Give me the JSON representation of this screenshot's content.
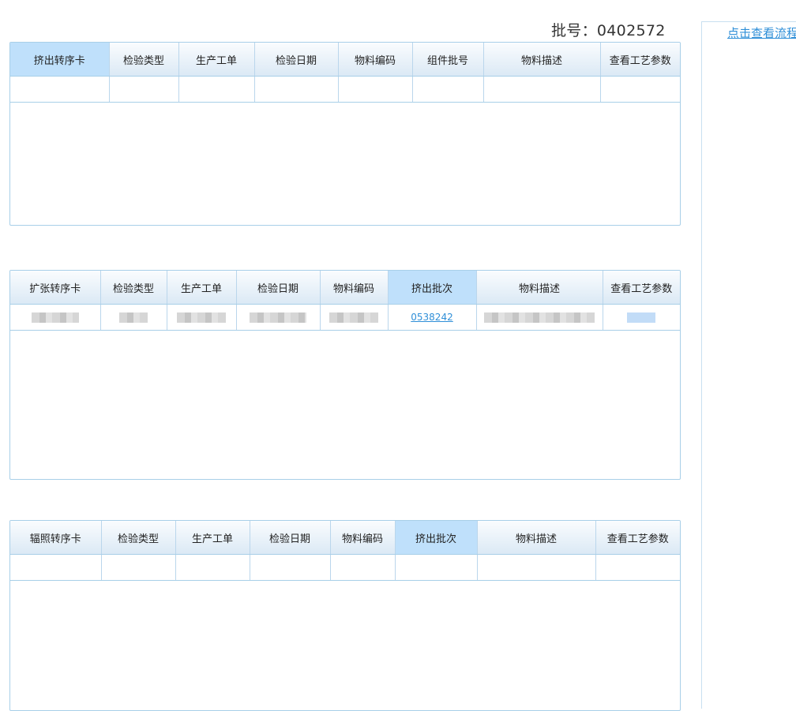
{
  "batch": {
    "label": "批号：",
    "value": "0402572"
  },
  "side": {
    "link_text": "点击查看流程"
  },
  "extrusion_table": {
    "columns": [
      "挤出转序卡",
      "检验类型",
      "生产工单",
      "检验日期",
      "物料编码",
      "组件批号",
      "物料描述",
      "查看工艺参数"
    ],
    "selected_column": 0
  },
  "expansion_table": {
    "columns": [
      "扩张转序卡",
      "检验类型",
      "生产工单",
      "检验日期",
      "物料编码",
      "挤出批次",
      "物料描述",
      "查看工艺参数"
    ],
    "selected_column": 5,
    "row": {
      "extrusion_batch": "0538242"
    }
  },
  "irradiation_table": {
    "columns": [
      "辐照转序卡",
      "检验类型",
      "生产工单",
      "检验日期",
      "物料编码",
      "挤出批次",
      "物料描述",
      "查看工艺参数"
    ],
    "selected_column": 5
  }
}
